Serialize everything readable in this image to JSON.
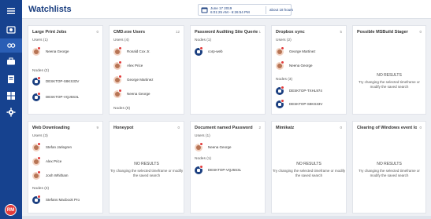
{
  "app": {
    "title": "Watchlists"
  },
  "timerange": {
    "line1": "June 17 2019",
    "line2": "6:01:25 AM - 6:26:54 PM",
    "ago": "about 18 hours"
  },
  "user": {
    "initials": "RM"
  },
  "cards": [
    {
      "title": "Large Print Jobs",
      "count": "0",
      "users_label": "Users (1)",
      "users": [
        "Neena George"
      ],
      "nodes_label": "Nodes (2)",
      "nodes": [
        "DESKTOP-S8KS33V",
        "DESKTOP-VQJ6S3L"
      ]
    },
    {
      "title": "CMD.exe Users",
      "count": "12",
      "users_label": "Users (4)",
      "users": [
        "Ronald Cox Jr.",
        "Alex Price",
        "George Martinez",
        "Neena George"
      ],
      "nodes_label": "Nodes (8)"
    },
    {
      "title": "Password Auditing Site Querie",
      "count": "1",
      "nodes_label": "Nodes (1)",
      "nodes": [
        "corp-web"
      ]
    },
    {
      "title": "Dropbox sync",
      "count": "5",
      "users_label": "Users (2)",
      "users": [
        "George Martinez",
        "Neena George"
      ],
      "nodes_label": "Nodes (3)",
      "nodes": [
        "DESKTOP-TXHL974",
        "DESKTOP-S8KS33V"
      ]
    },
    {
      "title": "Possible MSBuild Stager",
      "count": "0",
      "no_results": "NO RESULTS",
      "no_results_hint": "Try changing the selected timeframe or modify the saved search"
    },
    {
      "title": "Web Downloading",
      "count": "9",
      "users_label": "Users (3)",
      "users": [
        "Stefan Jarlegren",
        "Alex Price",
        "Josh Whitham"
      ],
      "nodes_label": "Nodes (3)",
      "nodes": [
        "Stefans Macbook Pro"
      ]
    },
    {
      "title": "Honeypot",
      "count": "0",
      "no_results": "NO RESULTS",
      "no_results_hint": "Try changing the selected timeframe or modify the saved search"
    },
    {
      "title": "Document named Password",
      "count": "2",
      "users_label": "Users (1)",
      "users": [
        "Neena George"
      ],
      "nodes_label": "Nodes (1)",
      "nodes": [
        "DESKTOP-VQJ6S3L"
      ]
    },
    {
      "title": "Mimikatz",
      "count": "0",
      "no_results": "NO RESULTS",
      "no_results_hint": "Try changing the selected timeframe or modify the saved search"
    },
    {
      "title": "Clearing of Windows event lo",
      "count": "0",
      "no_results": "NO RESULTS",
      "no_results_hint": "Try changing the selected timeframe or modify the saved search"
    }
  ],
  "sidebar": {
    "icons": [
      "menu-icon",
      "binoculars-icon",
      "watchlist-icon",
      "briefcase-icon",
      "report-icon",
      "dashboard-icon",
      "settings-icon"
    ]
  }
}
